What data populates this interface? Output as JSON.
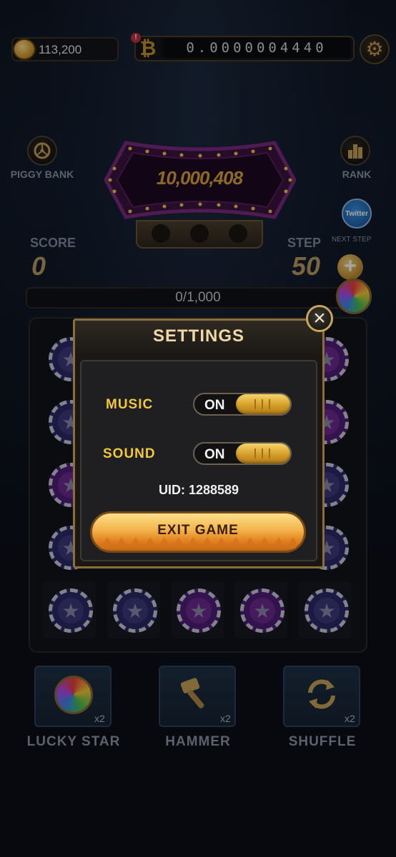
{
  "header": {
    "coins": "113,200",
    "btc_alert": "!",
    "btc_symbol": "₿",
    "btc_balance": "0.0000004440",
    "settings_icon": "gear-icon"
  },
  "left_widget": {
    "label": "PIGGY BANK",
    "icon": "piggy-bank-icon"
  },
  "right_widget": {
    "label": "RANK",
    "icon": "rank-bars-icon"
  },
  "jackpot": {
    "value": "10,000,408"
  },
  "social": {
    "label": "Twitter",
    "next_step_label": "NEXT STEP",
    "plus": "+"
  },
  "score": {
    "label": "SCORE",
    "value": "0"
  },
  "step": {
    "label": "STEP",
    "value": "50"
  },
  "progress": {
    "text": "0/1,000"
  },
  "boosters": [
    {
      "label": "LUCKY STAR",
      "count": "x2",
      "icon": "rainbow-orb-icon"
    },
    {
      "label": "HAMMER",
      "count": "x2",
      "icon": "hammer-icon"
    },
    {
      "label": "SHUFFLE",
      "count": "x2",
      "icon": "shuffle-icon"
    }
  ],
  "settings_dialog": {
    "title": "SETTINGS",
    "close_icon": "close-icon",
    "music_label": "MUSIC",
    "music_state": "ON",
    "sound_label": "SOUND",
    "sound_state": "ON",
    "uid": "UID: 1288589",
    "exit_label": "EXIT GAME"
  },
  "colors": {
    "accent_gold": "#f2c83a",
    "button_orange": "#f3b24a",
    "chip_blue": "#2a2868",
    "chip_purple": "#4e1e78"
  }
}
